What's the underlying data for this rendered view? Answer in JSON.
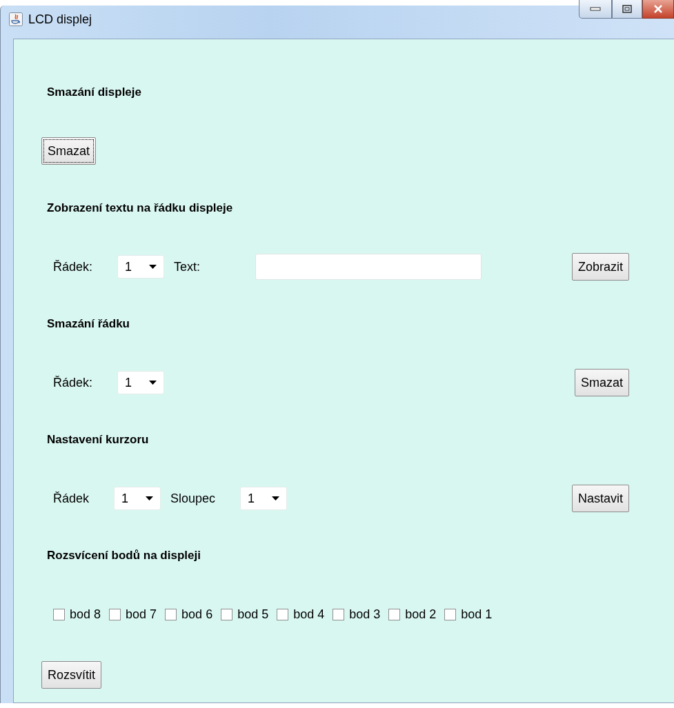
{
  "window": {
    "title": "LCD displej"
  },
  "sections": [
    {
      "heading": "Smazání displeje",
      "rows": [
        {
          "items": [
            {
              "kind": "button",
              "label": "Smazat"
            }
          ]
        }
      ]
    },
    {
      "heading": "Zobrazení textu na řádku displeje",
      "rows": [
        {
          "items": [
            {
              "kind": "label",
              "text": "Řádek:"
            },
            {
              "kind": "dropdown",
              "value": "1"
            },
            {
              "kind": "label",
              "text": "Text:"
            },
            {
              "kind": "text-field"
            }
          ],
          "action": {
            "label": "Zobrazit"
          }
        }
      ]
    },
    {
      "heading": "Smazání řádku",
      "rows": [
        {
          "items": [
            {
              "kind": "label",
              "text": "Řádek:"
            },
            {
              "kind": "dropdown",
              "value": "1"
            }
          ],
          "action": {
            "label": "Smazat"
          }
        }
      ]
    },
    {
      "heading": "Nastavení kurzoru",
      "rows": [
        {
          "items": [
            {
              "kind": "label",
              "text": "Řádek"
            },
            {
              "kind": "dropdown",
              "value": "1"
            },
            {
              "kind": "label",
              "text": "Sloupec"
            },
            {
              "kind": "dropdown",
              "value": "1"
            }
          ],
          "action": {
            "label": "Nastavit"
          }
        }
      ]
    },
    {
      "heading": "Rozsvícení bodů na displeji",
      "rows": [
        {
          "items": [
            {
              "kind": "checkbox",
              "label": "bod 8",
              "checked": false
            },
            {
              "kind": "checkbox",
              "label": "bod 7",
              "checked": false
            },
            {
              "kind": "checkbox",
              "label": "bod 6",
              "checked": false
            },
            {
              "kind": "checkbox",
              "label": "bod 5",
              "checked": false
            },
            {
              "kind": "checkbox",
              "label": "bod 4",
              "checked": false
            },
            {
              "kind": "checkbox",
              "label": "bod 3",
              "checked": false
            },
            {
              "kind": "checkbox",
              "label": "bod 2",
              "checked": false
            },
            {
              "kind": "checkbox",
              "label": "bod 1",
              "checked": false
            }
          ]
        },
        {
          "items": [
            {
              "kind": "button",
              "label": "Rozsvítit"
            }
          ]
        }
      ]
    }
  ]
}
